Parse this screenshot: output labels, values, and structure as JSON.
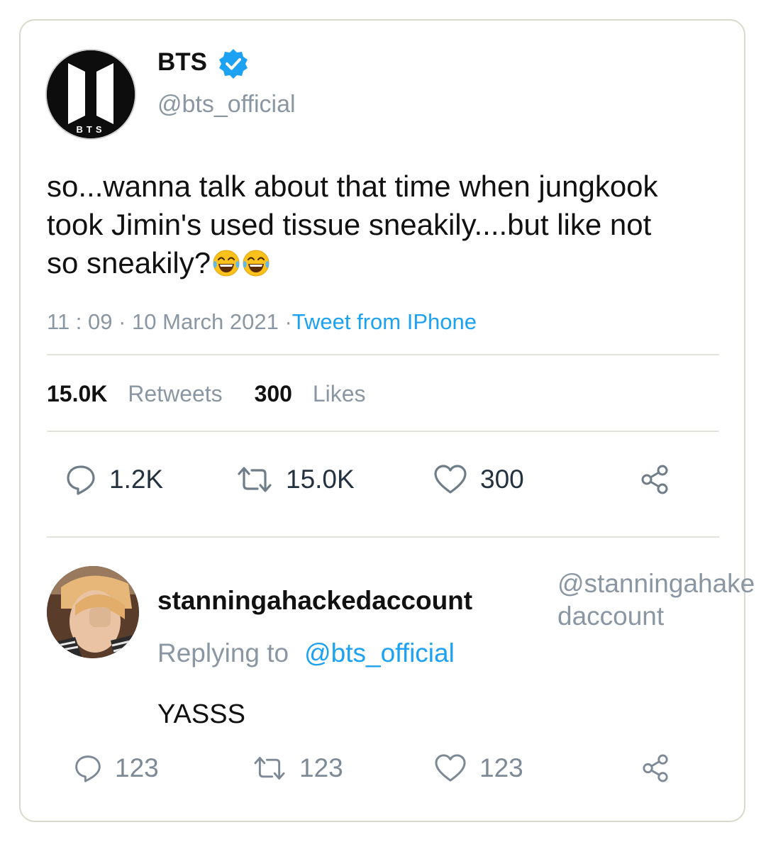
{
  "tweet": {
    "author": {
      "name": "BTS",
      "handle": "@bts_official",
      "avatar_logo_text": "BTS"
    },
    "text": "so...wanna talk about that time when jungkook took Jimin's used tissue sneakily....but like not so sneakily?",
    "emojis": [
      "face-with-tears-of-joy",
      "face-with-tears-of-joy"
    ],
    "time": "11 : 09 · 10 March 2021 ·",
    "source": "Tweet from IPhone",
    "stats": {
      "retweets_count": "15.0K",
      "retweets_label": "Retweets",
      "likes_count": "300",
      "likes_label": "Likes"
    },
    "actions": {
      "reply": "1.2K",
      "retweet": "15.0K",
      "like": "300"
    }
  },
  "reply": {
    "name": "stanningahackedaccount",
    "handle": "@stanningahakedaccount",
    "replying_label": "Replying to",
    "replying_to": "@bts_official",
    "text": "YASSS",
    "actions": {
      "reply": "123",
      "retweet": "123",
      "like": "123"
    }
  },
  "colors": {
    "link": "#1da1f2",
    "muted": "#8a97a3",
    "verified": "#1da1f2",
    "border": "#d9d9cc"
  }
}
